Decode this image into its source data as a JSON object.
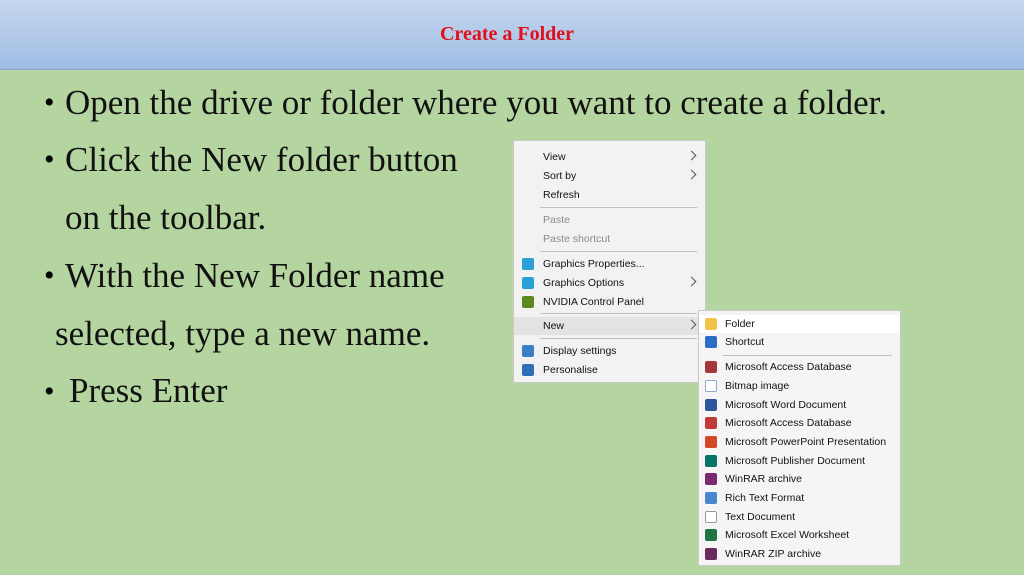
{
  "slide": {
    "title": "Create a Folder",
    "bullets": [
      {
        "bullet": "•",
        "text": "Open the drive or folder where you want to create a folder."
      },
      {
        "bullet": "•",
        "text": "Click the New folder button"
      },
      {
        "bullet": "",
        "text": "on the toolbar."
      },
      {
        "bullet": "•",
        "text": "With the New Folder name"
      },
      {
        "bullet": "",
        "text": "selected, type a new name."
      },
      {
        "bullet": "•",
        "text": "Press Enter"
      }
    ]
  },
  "context_menu": {
    "items": [
      {
        "label": "View",
        "icon": "",
        "submenu": true
      },
      {
        "label": "Sort by",
        "icon": "",
        "submenu": true
      },
      {
        "label": "Refresh",
        "icon": ""
      },
      {
        "label": "Paste",
        "icon": "",
        "disabled": true
      },
      {
        "label": "Paste shortcut",
        "icon": "",
        "disabled": true
      },
      {
        "label": "Graphics Properties...",
        "icon": "graphics-icon"
      },
      {
        "label": "Graphics Options",
        "icon": "graphics-icon",
        "submenu": true
      },
      {
        "label": "NVIDIA Control Panel",
        "icon": "nvidia-icon"
      },
      {
        "label": "New",
        "icon": "",
        "submenu": true,
        "highlighted": true
      },
      {
        "label": "Display settings",
        "icon": "display-icon"
      },
      {
        "label": "Personalise",
        "icon": "personalise-icon"
      }
    ]
  },
  "new_submenu": {
    "items": [
      {
        "label": "Folder",
        "icon": "folder-icon",
        "highlighted": true
      },
      {
        "label": "Shortcut",
        "icon": "shortcut-icon"
      },
      {
        "label": "Microsoft Access Database",
        "icon": "access-icon"
      },
      {
        "label": "Bitmap image",
        "icon": "bitmap-icon"
      },
      {
        "label": "Microsoft Word Document",
        "icon": "word-icon"
      },
      {
        "label": "Microsoft Access Database",
        "icon": "access-icon"
      },
      {
        "label": "Microsoft PowerPoint Presentation",
        "icon": "powerpoint-icon"
      },
      {
        "label": "Microsoft Publisher Document",
        "icon": "publisher-icon"
      },
      {
        "label": "WinRAR archive",
        "icon": "winrar-icon"
      },
      {
        "label": "Rich Text Format",
        "icon": "rtf-icon"
      },
      {
        "label": "Text Document",
        "icon": "text-icon"
      },
      {
        "label": "Microsoft Excel Worksheet",
        "icon": "excel-icon"
      },
      {
        "label": "WinRAR ZIP archive",
        "icon": "winrar-zip-icon"
      }
    ]
  },
  "colors": {
    "background": "#b5d5a0",
    "title_bar": "#9fbce4",
    "title_text": "#e2101a"
  }
}
